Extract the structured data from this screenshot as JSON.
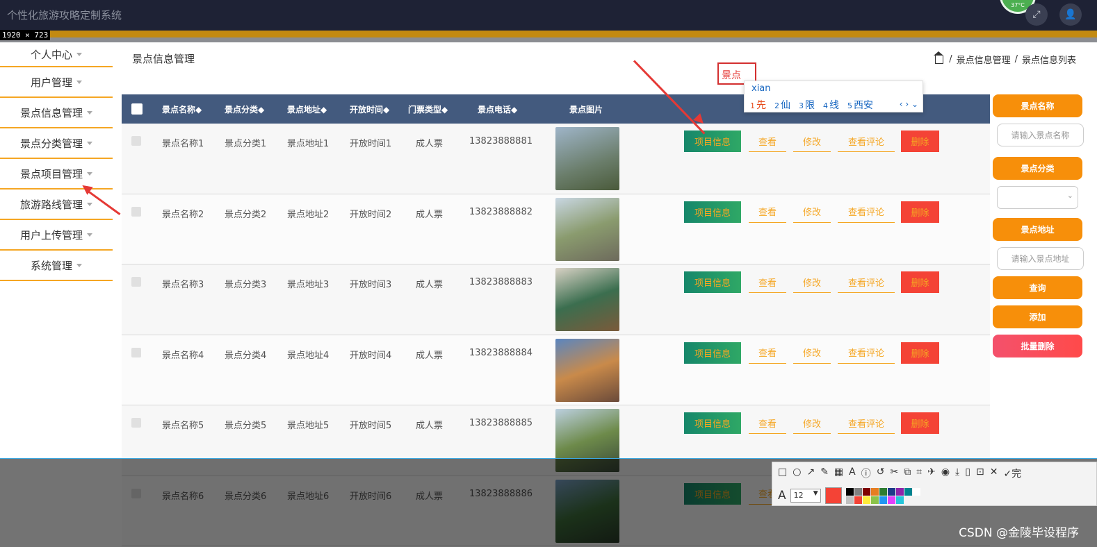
{
  "app": {
    "title": "个性化旅游攻略定制系统",
    "dimension_label": "1920 × 723",
    "temp_badge": "37°C"
  },
  "sidebar": {
    "items": [
      {
        "label": "个人中心"
      },
      {
        "label": "用户管理"
      },
      {
        "label": "景点信息管理"
      },
      {
        "label": "景点分类管理"
      },
      {
        "label": "景点项目管理"
      },
      {
        "label": "旅游路线管理"
      },
      {
        "label": "用户上传管理"
      },
      {
        "label": "系统管理"
      }
    ]
  },
  "header": {
    "page_title": "景点信息管理",
    "breadcrumb": [
      "景点信息管理",
      "景点信息列表"
    ],
    "breadcrumb_sep": "/"
  },
  "ime": {
    "input_value": "景点",
    "pinyin": "xian",
    "candidates": [
      {
        "num": "1",
        "text": "先"
      },
      {
        "num": "2",
        "text": "仙"
      },
      {
        "num": "3",
        "text": "限"
      },
      {
        "num": "4",
        "text": "线"
      },
      {
        "num": "5",
        "text": "西安"
      }
    ],
    "nav": "‹ › ⌄"
  },
  "table": {
    "headers": [
      "景点名称◆",
      "景点分类◆",
      "景点地址◆",
      "开放时间◆",
      "门票类型◆",
      "景点电话◆",
      "景点图片"
    ],
    "rows": [
      {
        "name": "景点名称1",
        "category": "景点分类1",
        "address": "景点地址1",
        "hours": "开放时间1",
        "ticket": "成人票",
        "phone": "13823888881"
      },
      {
        "name": "景点名称2",
        "category": "景点分类2",
        "address": "景点地址2",
        "hours": "开放时间2",
        "ticket": "成人票",
        "phone": "13823888882"
      },
      {
        "name": "景点名称3",
        "category": "景点分类3",
        "address": "景点地址3",
        "hours": "开放时间3",
        "ticket": "成人票",
        "phone": "13823888883"
      },
      {
        "name": "景点名称4",
        "category": "景点分类4",
        "address": "景点地址4",
        "hours": "开放时间4",
        "ticket": "成人票",
        "phone": "13823888884"
      },
      {
        "name": "景点名称5",
        "category": "景点分类5",
        "address": "景点地址5",
        "hours": "开放时间5",
        "ticket": "成人票",
        "phone": "13823888885"
      },
      {
        "name": "景点名称6",
        "category": "景点分类6",
        "address": "景点地址6",
        "hours": "开放时间6",
        "ticket": "成人票",
        "phone": "13823888886"
      }
    ],
    "actions": {
      "info": "项目信息",
      "view": "查看",
      "edit": "修改",
      "review": "查看评论",
      "delete": "删除"
    }
  },
  "search_panel": {
    "name_label": "景点名称",
    "name_placeholder": "请输入景点名称",
    "category_label": "景点分类",
    "address_label": "景点地址",
    "address_placeholder": "请输入景点地址",
    "query_button": "查询",
    "add_button": "添加",
    "batch_delete_button": "批量删除"
  },
  "snip_toolbar": {
    "tools": [
      "□",
      "○",
      "↗",
      "✎",
      "▦",
      "A",
      "ⓘ",
      "↺",
      "✂",
      "⧉",
      "⌗",
      "✈",
      "◉",
      "⤓",
      "▯",
      "⊡",
      "✕",
      "✓完"
    ],
    "text_icon": "A",
    "font_size": "12",
    "colors": [
      "#000000",
      "#808080",
      "#800000",
      "#e67e22",
      "#2e7d32",
      "#1e3a8a",
      "#8e24aa",
      "#00838f",
      "#ffffff",
      "#c0c0c0",
      "#f44336",
      "#ffeb3b",
      "#8bc34a",
      "#2196f3",
      "#e040fb",
      "#26c6da"
    ]
  },
  "watermark": "CSDN @金陵毕设程序"
}
